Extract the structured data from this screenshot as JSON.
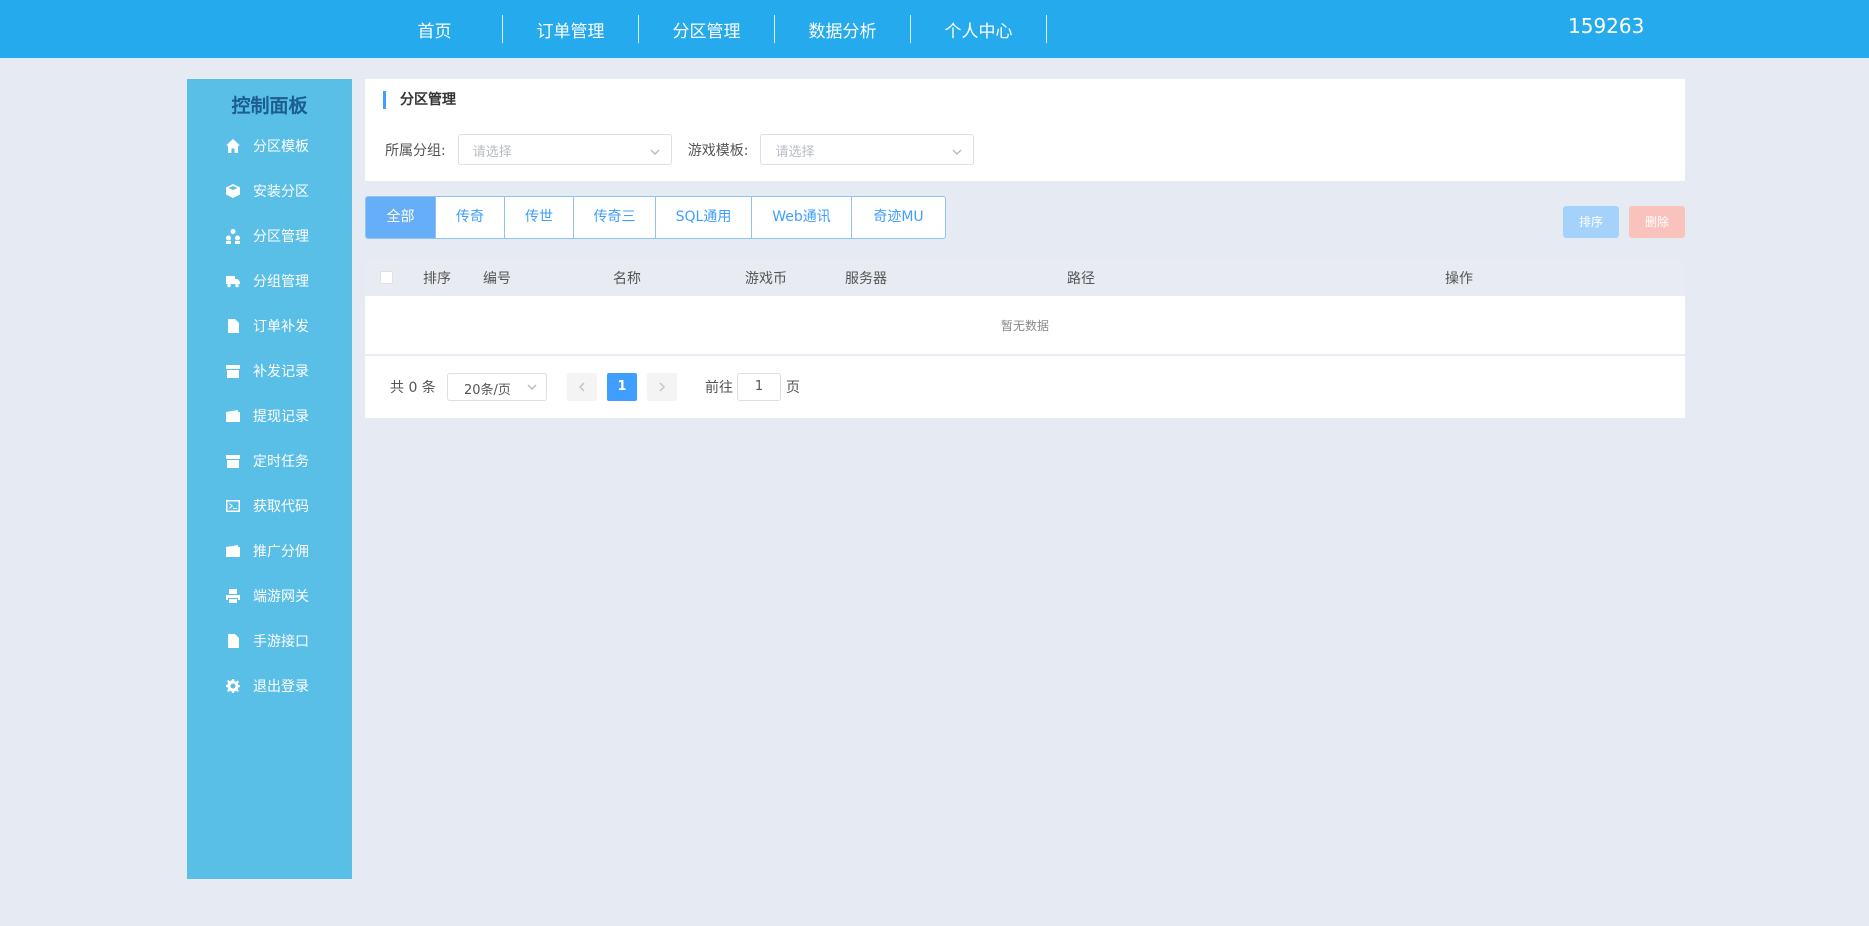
{
  "topnav": {
    "items": [
      {
        "label": "首页"
      },
      {
        "label": "订单管理"
      },
      {
        "label": "分区管理"
      },
      {
        "label": "数据分析"
      },
      {
        "label": "个人中心"
      }
    ],
    "user_id": "159263"
  },
  "sidebar": {
    "title": "控制面板",
    "items": [
      {
        "label": "分区模板",
        "icon": "home-icon"
      },
      {
        "label": "安装分区",
        "icon": "cube-icon"
      },
      {
        "label": "分区管理",
        "icon": "users-icon"
      },
      {
        "label": "分组管理",
        "icon": "truck-icon"
      },
      {
        "label": "订单补发",
        "icon": "document-icon"
      },
      {
        "label": "补发记录",
        "icon": "archive-icon"
      },
      {
        "label": "提现记录",
        "icon": "wallet-icon"
      },
      {
        "label": "定时任务",
        "icon": "archive-icon"
      },
      {
        "label": "获取代码",
        "icon": "code-icon"
      },
      {
        "label": "推广分佣",
        "icon": "wallet-icon"
      },
      {
        "label": "端游网关",
        "icon": "printer-icon"
      },
      {
        "label": "手游接口",
        "icon": "document-icon"
      },
      {
        "label": "退出登录",
        "icon": "gear-icon"
      }
    ]
  },
  "main": {
    "section_title": "分区管理",
    "filters": {
      "group_label": "所属分组:",
      "group_placeholder": "请选择",
      "template_label": "游戏模板:",
      "template_placeholder": "请选择"
    },
    "tabs": [
      {
        "label": "全部"
      },
      {
        "label": "传奇"
      },
      {
        "label": "传世"
      },
      {
        "label": "传奇三"
      },
      {
        "label": "SQL通用"
      },
      {
        "label": "Web通讯"
      },
      {
        "label": "奇迹MU"
      }
    ],
    "active_tab": "全部",
    "buttons": {
      "sort": "排序",
      "delete": "删除"
    },
    "table": {
      "columns": [
        "排序",
        "编号",
        "名称",
        "游戏币",
        "服务器",
        "路径",
        "操作"
      ],
      "empty_text": "暂无数据"
    },
    "pagination": {
      "total": "共 0 条",
      "page_size": "20条/页",
      "current_page": "1",
      "goto_label": "前往",
      "goto_value": "1",
      "page_unit": "页"
    }
  },
  "colors": {
    "topbar": "#24aaed",
    "sidebar": "#5abfe7",
    "accent": "#409eff",
    "page_bg": "#e6ebf3"
  }
}
